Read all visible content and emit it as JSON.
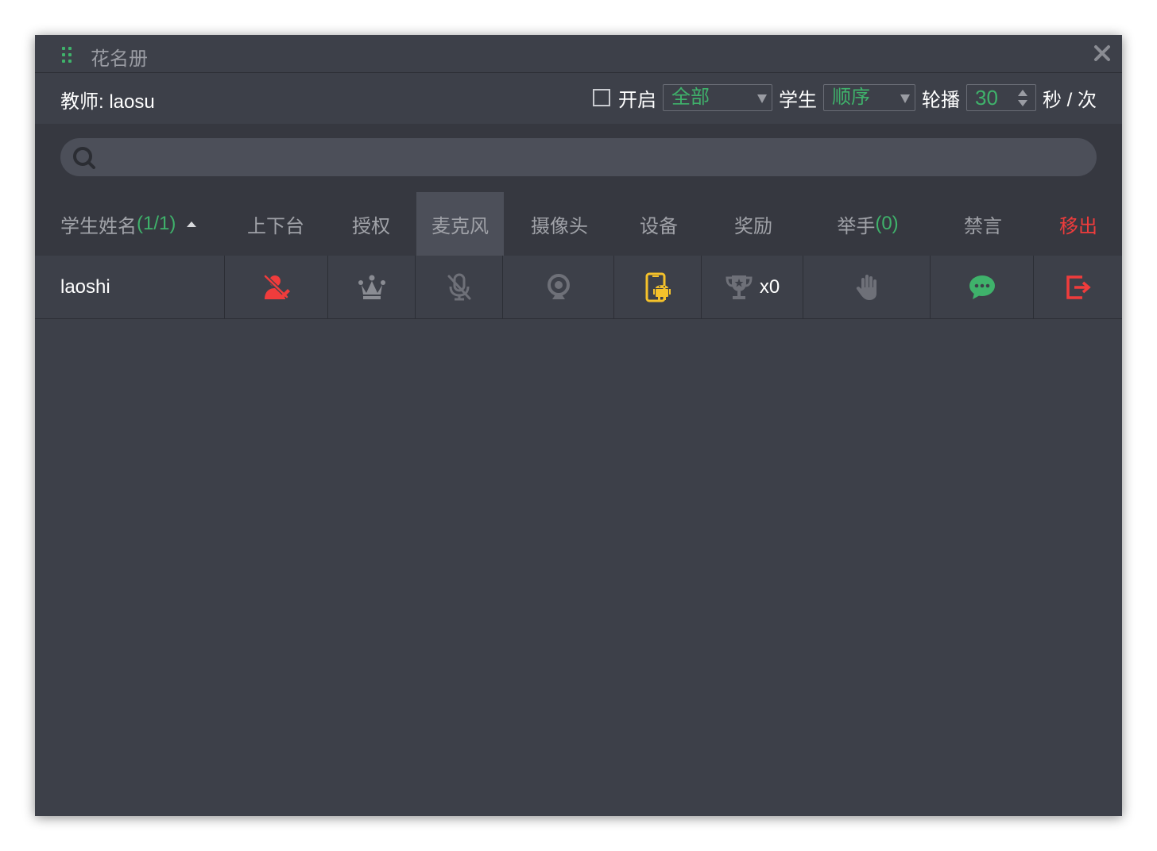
{
  "window": {
    "title": "花名册"
  },
  "toolbar": {
    "teacher_label": "教师:",
    "teacher_name": "laosu",
    "enable_label": "开启",
    "scope_value": "全部",
    "student_label": "学生",
    "order_value": "顺序",
    "rotate_label": "轮播",
    "interval_value": "30",
    "unit_label": "秒 / 次",
    "enable_checked": false
  },
  "search": {
    "placeholder": "",
    "value": ""
  },
  "table": {
    "headers": {
      "name": "学生姓名",
      "name_count": "(1/1)",
      "stage": "上下台",
      "authorize": "授权",
      "mic": "麦克风",
      "camera": "摄像头",
      "device": "设备",
      "reward": "奖励",
      "raise_hand": "举手",
      "raise_hand_count": "(0)",
      "mute": "禁言",
      "remove": "移出"
    },
    "active_column": "mic",
    "rows": [
      {
        "name": "laoshi",
        "stage_icon": "user-off-stage-icon",
        "authorize_icon": "crown-icon",
        "mic_icon": "mic-off-icon",
        "camera_icon": "webcam-icon",
        "device_icon": "android-phone-icon",
        "reward_icon": "trophy-icon",
        "reward_count": "x0",
        "hand_icon": "hand-icon",
        "chat_icon": "chat-bubble-icon",
        "remove_icon": "exit-icon"
      }
    ]
  },
  "colors": {
    "background": "#3d4049",
    "header_background": "#363840",
    "accent_green": "#3fb26b",
    "danger_red": "#f03c3c",
    "device_yellow": "#f5c22b",
    "muted_text": "#a0a2a8"
  }
}
